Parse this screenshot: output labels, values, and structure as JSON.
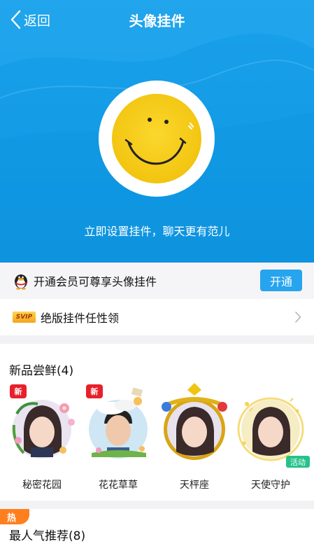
{
  "nav": {
    "back_label": "返回",
    "title": "头像挂件"
  },
  "hero": {
    "caption": "立即设置挂件，聊天更有范儿"
  },
  "vip_row": {
    "text": "开通会员可尊享头像挂件",
    "button": "开通"
  },
  "svip_row": {
    "badge": "SVIP",
    "text": "绝版挂件任性领"
  },
  "new_section": {
    "title": "新品尝鲜(4)",
    "items": [
      {
        "label": "秘密花园",
        "badge": "新"
      },
      {
        "label": "花花草草",
        "badge": "新"
      },
      {
        "label": "天枰座",
        "badge": ""
      },
      {
        "label": "天使守护",
        "badge": "活动"
      }
    ]
  },
  "hot_section": {
    "tag": "热",
    "title": "最人气推荐(8)"
  },
  "colors": {
    "primary_blue": "#129be6",
    "button_blue": "#27a4ee",
    "new_red": "#e8202b",
    "activity_green": "#27c28a",
    "hot_orange": "#ff7f1f"
  }
}
